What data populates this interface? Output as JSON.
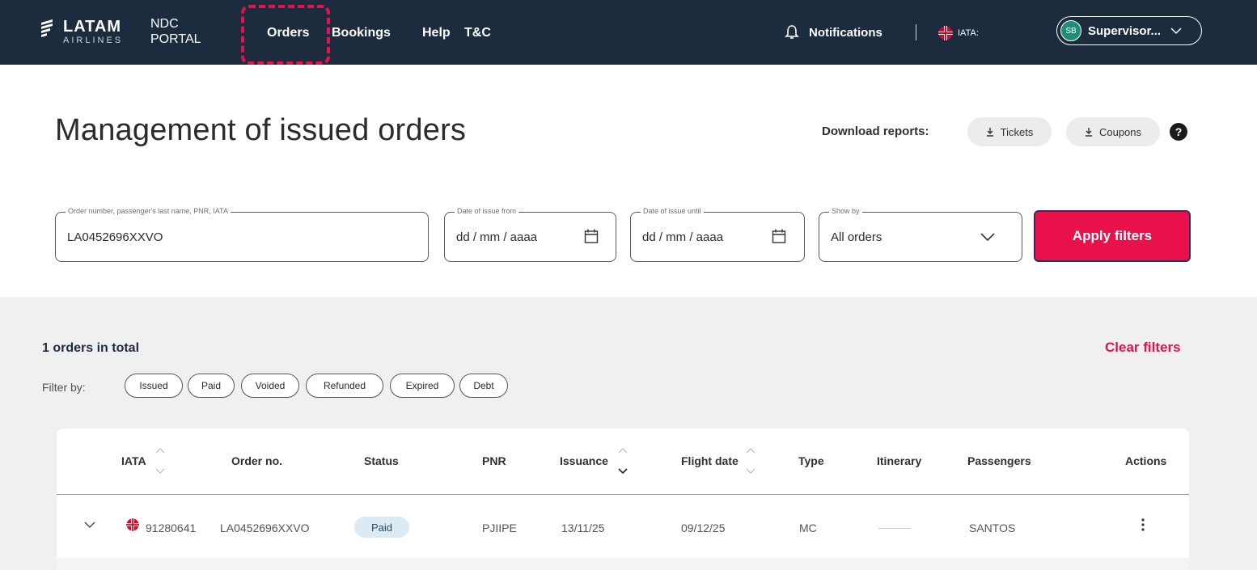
{
  "header": {
    "brand": "LATAM",
    "brand_sub": "AIRLINES",
    "portal_line1": "NDC",
    "portal_line2": "PORTAL",
    "nav": [
      "Orders",
      "Bookings",
      "Help",
      "T&C"
    ],
    "notifications_label": "Notifications",
    "iata_label": "IATA:",
    "avatar_initials": "SB",
    "user_label": "Supervisor..."
  },
  "page": {
    "title": "Management of issued orders",
    "download_label": "Download reports:",
    "download_buttons": [
      "Tickets",
      "Coupons"
    ]
  },
  "filters": {
    "search": {
      "label": "Order number, passenger's last name, PNR, IATA",
      "value": "LA0452696XXVO"
    },
    "date_from": {
      "label": "Date of issue from",
      "value": "dd / mm / aaaa"
    },
    "date_until": {
      "label": "Date of issue until",
      "value": "dd / mm / aaaa"
    },
    "show_by": {
      "label": "Show by",
      "value": "All orders"
    },
    "apply_label": "Apply filters"
  },
  "results": {
    "total_text": "1 orders in total",
    "clear_label": "Clear filters",
    "filter_by_label": "Filter by:",
    "chips": [
      "Issued",
      "Paid",
      "Voided",
      "Refunded",
      "Expired",
      "Debt"
    ]
  },
  "table": {
    "columns": [
      "IATA",
      "Order no.",
      "Status",
      "PNR",
      "Issuance",
      "Flight date",
      "Type",
      "Itinerary",
      "Passengers",
      "Actions"
    ],
    "rows": [
      {
        "iata": "91280641",
        "order_no": "LA0452696XXVO",
        "status": "Paid",
        "pnr": "PJIIPE",
        "issuance": "13/11/25",
        "flight_date": "09/12/25",
        "type": "MC",
        "passengers": "SANTOS"
      }
    ]
  },
  "colors": {
    "navy": "#1c2b3e",
    "accent": "#e8114b",
    "badge": "#dbeaf3"
  }
}
